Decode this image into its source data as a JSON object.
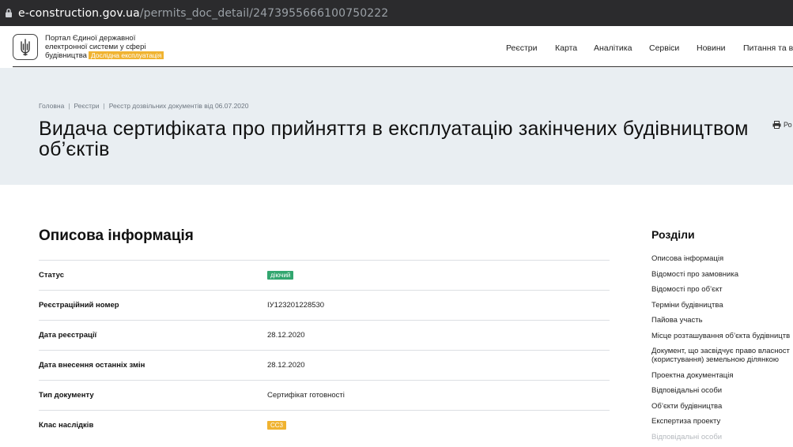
{
  "browser": {
    "url_host": "e-construction.gov.ua",
    "url_path": "/permits_doc_detail/247395566610075022​2"
  },
  "header": {
    "brand_line1": "Портал Єдиної державної",
    "brand_line2": "електронної системи у сфері",
    "brand_line3": "будівництва",
    "brand_badge": "Дослідна експлуатація",
    "nav": [
      "Реєстри",
      "Карта",
      "Аналітика",
      "Сервіси",
      "Новини",
      "Питання та в"
    ]
  },
  "hero": {
    "breadcrumbs": [
      "Головна",
      "Реєстри",
      "Реєстр дозвільних документів від 06.07.2020"
    ],
    "title": "Видача сертифіката про прийняття в експлуатацію закінчених будівництвом об’єктів",
    "print_label": "Ро"
  },
  "main": {
    "section_title": "Описова інформація",
    "rows": [
      {
        "label": "Статус",
        "value": "діючий"
      },
      {
        "label": "Реєстраційний номер",
        "value": "IУ123201228530"
      },
      {
        "label": "Дата реєстрації",
        "value": "28.12.2020"
      },
      {
        "label": "Дата внесення останніх змін",
        "value": "28.12.2020"
      },
      {
        "label": "Тип документу",
        "value": "Сертифікат готовності"
      },
      {
        "label": "Клас наслідків",
        "value": "СС3"
      }
    ]
  },
  "sidebar": {
    "title": "Розділи",
    "items": [
      "Описова інформація",
      "Відомості про замовника",
      "Відомості про об’єкт",
      "Терміни будівництва",
      "Пайова участь",
      "Місце розташування об’єкта будівництв",
      "Документ, що засвідчує право власност",
      "(користування) земельною ділянкою",
      "Проектна документація",
      "Відповідальні особи",
      "Об’єкти будівництва",
      "Експертиза проекту",
      "Відповідальні особи"
    ]
  },
  "colors": {
    "status_active": "#32a66f",
    "class_badge": "#f0b331",
    "hero_bg": "#e9eef2"
  }
}
